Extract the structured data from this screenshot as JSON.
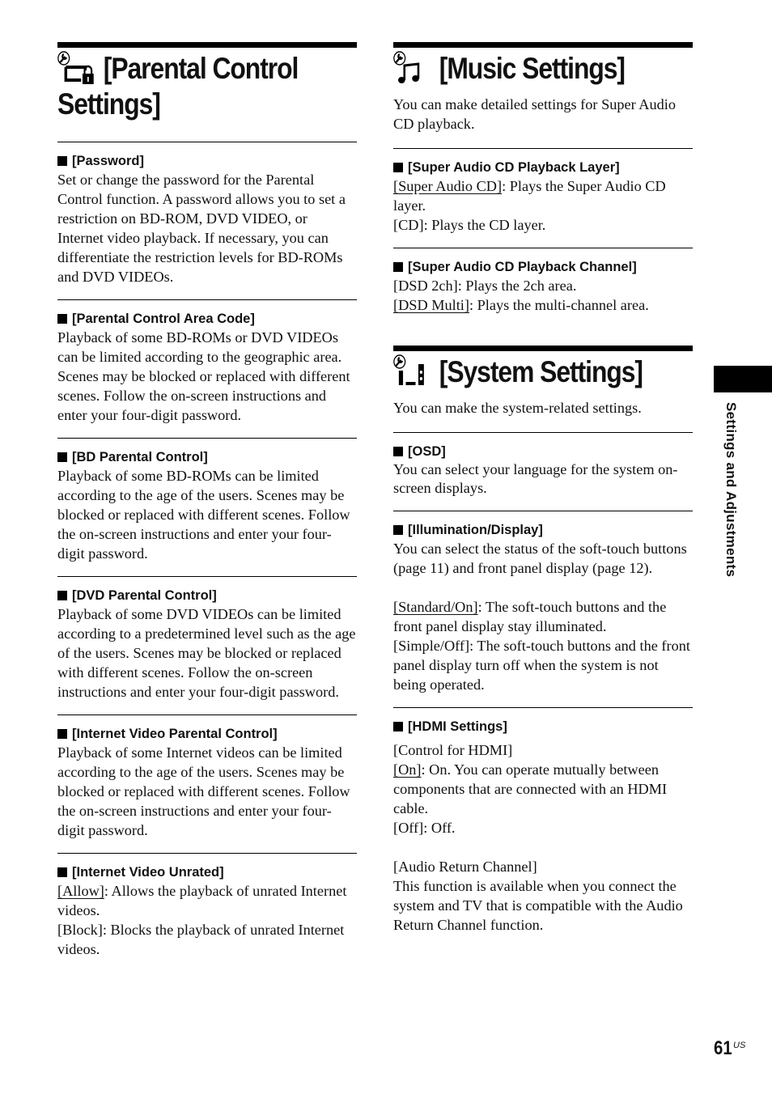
{
  "sidebar_tab": {
    "label": "Settings and Adjustments"
  },
  "page": {
    "number": "61",
    "region": "US"
  },
  "parental": {
    "title_line1": "[Parental Control",
    "title_line2": "Settings]",
    "icon": "wrench-lock-icon",
    "items": [
      {
        "heading": "[Password]",
        "lines": [
          "Set or change the password for the Parental Control function. A password allows you to set a restriction on BD-ROM, DVD VIDEO, or Internet video playback. If necessary, you can differentiate the restriction levels for BD-ROMs and DVD VIDEOs."
        ]
      },
      {
        "heading": "[Parental Control Area Code]",
        "lines": [
          "Playback of some BD-ROMs or DVD VIDEOs can be limited according to the geographic area. Scenes may be blocked or replaced with different scenes. Follow the on-screen instructions and enter your four-digit password."
        ]
      },
      {
        "heading": "[BD Parental Control]",
        "lines": [
          "Playback of some BD-ROMs can be limited according to the age of the users. Scenes may be blocked or replaced with different scenes. Follow the on-screen instructions and enter your four-digit password."
        ]
      },
      {
        "heading": "[DVD Parental Control]",
        "lines": [
          "Playback of some DVD VIDEOs can be limited according to a predetermined level such as the age of the users. Scenes may be blocked or replaced with different scenes. Follow the on-screen instructions and enter your four-digit password."
        ]
      },
      {
        "heading": "[Internet Video Parental Control]",
        "lines": [
          "Playback of some Internet videos can be limited according to the age of the users. Scenes may be blocked or replaced with different scenes. Follow the on-screen instructions and enter your four-digit password."
        ]
      },
      {
        "heading": "[Internet Video Unrated]",
        "options": [
          {
            "label": "[Allow]",
            "default": true,
            "desc": ": Allows the playback of unrated Internet videos."
          },
          {
            "label": "[Block]",
            "default": false,
            "desc": ": Blocks the playback of unrated Internet videos."
          }
        ]
      }
    ]
  },
  "music": {
    "title": "[Music Settings]",
    "icon": "wrench-music-icon",
    "intro": "You can make detailed settings for Super Audio CD playback.",
    "items": [
      {
        "heading": "[Super Audio CD Playback Layer]",
        "options": [
          {
            "label": "[Super Audio CD]",
            "default": true,
            "desc": ": Plays the Super Audio CD layer."
          },
          {
            "label": "[CD]",
            "default": false,
            "desc": ": Plays the CD layer."
          }
        ]
      },
      {
        "heading": "[Super Audio CD Playback Channel]",
        "options": [
          {
            "label": "[DSD 2ch]",
            "default": false,
            "desc": ": Plays the 2ch area."
          },
          {
            "label": "[DSD Multi]",
            "default": true,
            "desc": ": Plays the multi-channel area."
          }
        ]
      }
    ]
  },
  "system": {
    "title": "[System Settings]",
    "icon": "wrench-system-icon",
    "intro": "You can make the system-related settings.",
    "osd": {
      "heading": "[OSD]",
      "text": "You can select your language for the system on-screen displays."
    },
    "illum": {
      "heading": "[Illumination/Display]",
      "text": "You can select the status of the soft-touch buttons (page 11) and front panel display (page 12).",
      "options": [
        {
          "label": "[Standard/On]",
          "default": true,
          "desc": ": The soft-touch buttons and the front panel display stay illuminated."
        },
        {
          "label": "[Simple/Off]",
          "default": false,
          "desc": ": The soft-touch buttons and the front panel display turn off when the system is not being operated."
        }
      ]
    },
    "hdmi": {
      "heading": "[HDMI Settings]",
      "control_label": "[Control for HDMI]",
      "options": [
        {
          "label": "[On]",
          "default": true,
          "desc": ": On. You can operate mutually between components that are connected with an HDMI cable."
        },
        {
          "label": "[Off]",
          "default": false,
          "desc": ": Off."
        }
      ],
      "arc_label": "[Audio Return Channel]",
      "arc_text": "This function is available when you connect the system and TV that is compatible with the Audio Return Channel function."
    }
  }
}
